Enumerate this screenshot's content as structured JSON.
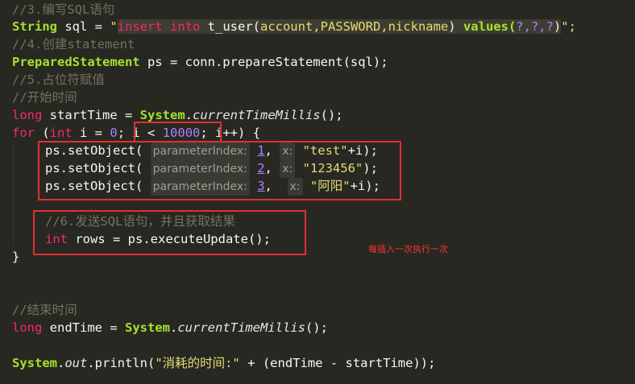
{
  "comments": {
    "c1": "//3.编写SQL语句",
    "c2": "//4.创建statement",
    "c3": "//5.占位符赋值",
    "c4": "//开始时间",
    "c5": "//6.发送SQL语句，并且获取结果",
    "c6": "//结束时间"
  },
  "code": {
    "string_kw": "String",
    "sql_var": " sql = ",
    "sql_str_open": "\"",
    "sql_insert": "insert into",
    "sql_table": " t_user(",
    "sql_cols": "account,PASSWORD,nickname",
    "sql_close": ") ",
    "sql_values": "values(",
    "sql_q": "?,?,?",
    "sql_end_paren": ")",
    "sql_end": "\";",
    "ps_type": "PreparedStatement",
    "ps_assign": " ps = conn.prepareStatement(sql);",
    "long_kw": "long",
    "start_decl": " startTime = ",
    "system": "System",
    "dot": ".",
    "millis": "currentTimeMillis",
    "paren_semi": "();",
    "for_kw": "for",
    "for_open": " (",
    "int_kw": "int",
    "for_init": " i = ",
    "zero": "0",
    "semi": ";",
    "cond_i": " i < ",
    "cond_num": "10000",
    "for_tail": "; i++) {",
    "set_call": "ps.setObject(",
    "hint_param": "parameterIndex:",
    "hint_x": "x:",
    "idx1": "1",
    "idx2": "2",
    "idx3": "3",
    "comma": ",",
    "val1": "\"test\"",
    "plus_i_end": "+i);",
    "val2": "\"123456\"",
    "val2_end": ");",
    "val3": "\"阿阳\"",
    "rows_decl": " rows = ps.executeUpdate();",
    "brace": "}",
    "end_decl": " endTime = ",
    "out": "out",
    "println": ".println(",
    "msg": "\"消耗的时间:\"",
    "expr": " + (endTime - startTime));"
  },
  "annotation": "每插入一次执行一次",
  "colors": {
    "background": "#272822",
    "comment": "#75715e",
    "keyword": "#f92672",
    "type": "#a6e22e",
    "string": "#e6db74",
    "number": "#ae81ff",
    "box": "#e03030",
    "note": "#ff3333"
  }
}
